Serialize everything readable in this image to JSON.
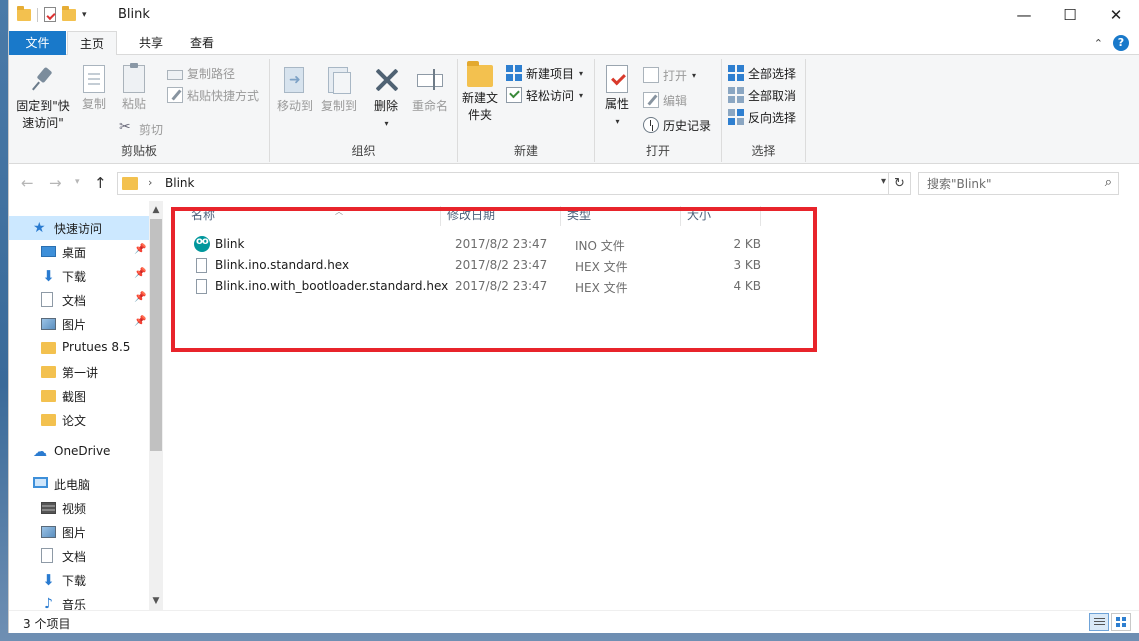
{
  "window": {
    "title": "Blink",
    "controls": {
      "minimize": "—",
      "maximize": "☐",
      "close": "✕"
    }
  },
  "ribbon_tabs": {
    "file": "文件",
    "home": "主页",
    "share": "共享",
    "view": "查看"
  },
  "ribbon": {
    "clipboard": {
      "label": "剪贴板",
      "pin": "固定到\"快速访问\"",
      "copy": "复制",
      "paste": "粘贴",
      "copy_path": "复制路径",
      "paste_shortcut": "粘贴快捷方式",
      "cut": "剪切"
    },
    "organize": {
      "label": "组织",
      "move_to": "移动到",
      "copy_to": "复制到",
      "delete": "删除",
      "rename": "重命名"
    },
    "new": {
      "label": "新建",
      "new_folder": "新建文件夹",
      "new_item": "新建项目",
      "easy_access": "轻松访问"
    },
    "open": {
      "label": "打开",
      "properties": "属性",
      "open": "打开",
      "edit": "编辑",
      "history": "历史记录"
    },
    "select": {
      "label": "选择",
      "select_all": "全部选择",
      "select_none": "全部取消",
      "invert": "反向选择"
    }
  },
  "address": {
    "path": "Blink",
    "search_placeholder": "搜索\"Blink\""
  },
  "nav_pane": {
    "quick_access": "快速访问",
    "items": [
      {
        "label": "桌面",
        "icon": "desktop-icon",
        "pinned": true
      },
      {
        "label": "下载",
        "icon": "download-icon",
        "pinned": true
      },
      {
        "label": "文档",
        "icon": "documents-icon",
        "pinned": true
      },
      {
        "label": "图片",
        "icon": "pictures-icon",
        "pinned": true
      },
      {
        "label": "Prutues 8.5",
        "icon": "folder-icon",
        "pinned": false
      },
      {
        "label": "第一讲",
        "icon": "folder-icon",
        "pinned": false
      },
      {
        "label": "截图",
        "icon": "folder-icon",
        "pinned": false
      },
      {
        "label": "论文",
        "icon": "folder-icon",
        "pinned": false
      }
    ],
    "onedrive": "OneDrive",
    "this_pc": "此电脑",
    "pc_items": [
      {
        "label": "视频",
        "icon": "videos-icon"
      },
      {
        "label": "图片",
        "icon": "pictures-icon"
      },
      {
        "label": "文档",
        "icon": "documents-icon"
      },
      {
        "label": "下载",
        "icon": "download-icon"
      },
      {
        "label": "音乐",
        "icon": "music-icon"
      }
    ]
  },
  "file_list": {
    "columns": {
      "name": "名称",
      "date": "修改日期",
      "type": "类型",
      "size": "大小"
    },
    "rows": [
      {
        "name": "Blink",
        "date": "2017/8/2 23:47",
        "type": "INO 文件",
        "size": "2 KB",
        "icon": "arduino-icon"
      },
      {
        "name": "Blink.ino.standard.hex",
        "date": "2017/8/2 23:47",
        "type": "HEX 文件",
        "size": "3 KB",
        "icon": "file-icon"
      },
      {
        "name": "Blink.ino.with_bootloader.standard.hex",
        "date": "2017/8/2 23:47",
        "type": "HEX 文件",
        "size": "4 KB",
        "icon": "file-icon"
      }
    ]
  },
  "status": {
    "count": "3 个项目"
  },
  "colors": {
    "accent": "#1979ca",
    "highlight_box": "#e8242b",
    "selected_nav": "#cce8ff"
  }
}
